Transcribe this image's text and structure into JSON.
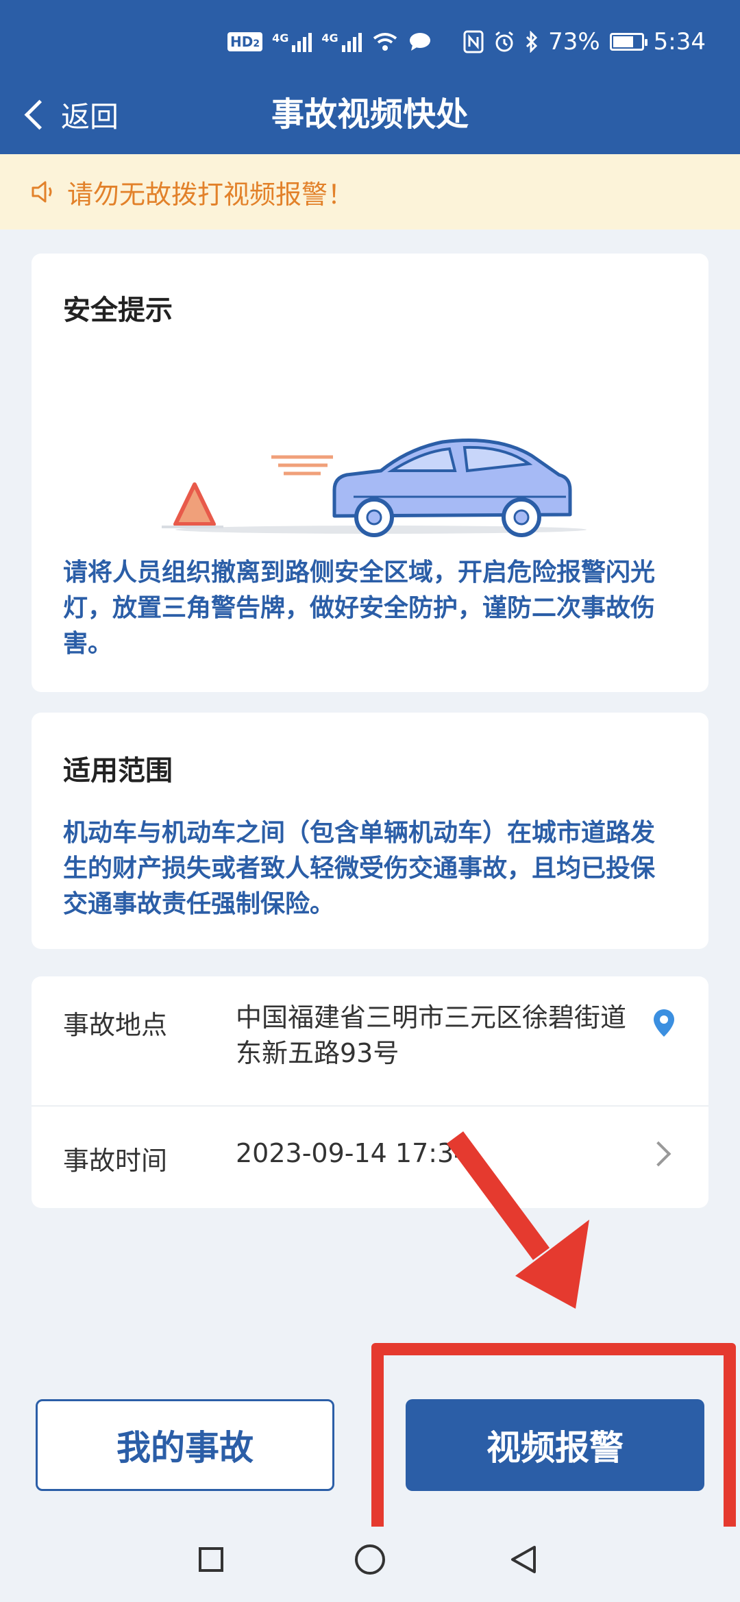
{
  "status_bar": {
    "hd_label": "HD",
    "hd_sub": "2",
    "net_1": "4G",
    "net_2": "4G",
    "battery_percent": "73%",
    "battery_level": 0.73,
    "time": "5:34"
  },
  "nav": {
    "back_label": "返回",
    "title": "事故视频快处"
  },
  "notice": {
    "text": "请勿无故拨打视频报警！",
    "icon": "speaker-icon"
  },
  "safety_card": {
    "title": "安全提示",
    "body": "请将人员组织撤离到路侧安全区域，开启危险报警闪光灯，放置三角警告牌，做好安全防护，谨防二次事故伤害。"
  },
  "scope_card": {
    "title": "适用范围",
    "body": "机动车与机动车之间（包含单辆机动车）在城市道路发生的财产损失或者致人轻微受伤交通事故，且均已投保交通事故责任强制保险。"
  },
  "info": {
    "location_label": "事故地点",
    "location_value": "中国福建省三明市三元区徐碧街道东新五路93号",
    "time_label": "事故时间",
    "time_value": "2023-09-14 17:34"
  },
  "actions": {
    "my_accidents": "我的事故",
    "video_report": "视频报警"
  },
  "colors": {
    "primary": "#2b5ea7",
    "notice_bg": "#fcf3d9",
    "notice_text": "#e2812a",
    "annotation": "#e53a2f"
  }
}
